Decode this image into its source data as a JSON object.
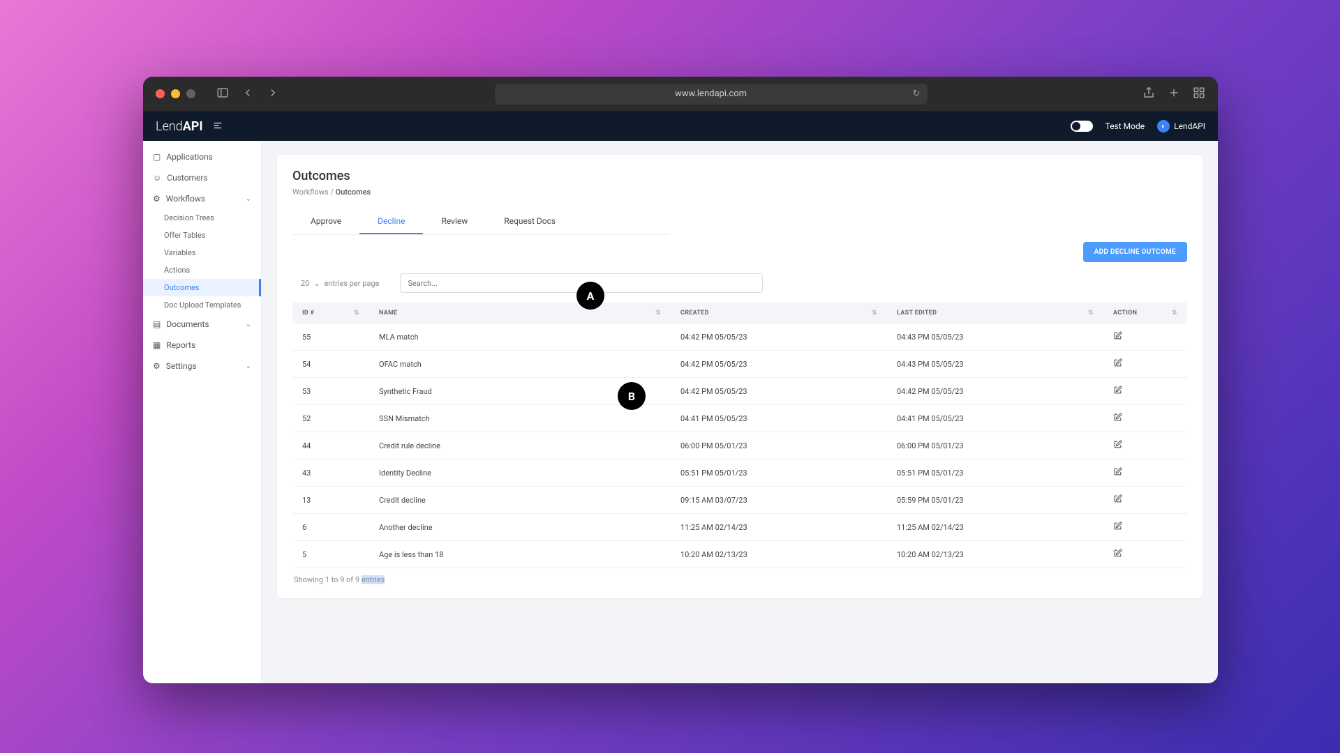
{
  "browser": {
    "url": "www.lendapi.com"
  },
  "header": {
    "brand_pre": "Lend",
    "brand_post": "API",
    "toggle_label": "Test Mode",
    "tenant": "LendAPI"
  },
  "sidebar": {
    "items": [
      {
        "label": "Applications"
      },
      {
        "label": "Customers"
      },
      {
        "label": "Workflows"
      }
    ],
    "workflow_children": [
      {
        "label": "Decision Trees"
      },
      {
        "label": "Offer Tables"
      },
      {
        "label": "Variables"
      },
      {
        "label": "Actions"
      },
      {
        "label": "Outcomes"
      },
      {
        "label": "Doc Upload Templates"
      }
    ],
    "items2": [
      {
        "label": "Documents"
      },
      {
        "label": "Reports"
      },
      {
        "label": "Settings"
      }
    ]
  },
  "page": {
    "title": "Outcomes",
    "breadcrumb_root": "Workflows",
    "breadcrumb_current": "Outcomes"
  },
  "tabs": [
    {
      "label": "Approve"
    },
    {
      "label": "Decline"
    },
    {
      "label": "Review"
    },
    {
      "label": "Request Docs"
    }
  ],
  "add_button": "ADD DECLINE OUTCOME",
  "entries": {
    "size": "20",
    "suffix": "entries per page"
  },
  "search": {
    "placeholder": "Search..."
  },
  "columns": {
    "id": "ID #",
    "name": "NAME",
    "created": "CREATED",
    "last_edited": "LAST EDITED",
    "action": "ACTION"
  },
  "rows": [
    {
      "id": "55",
      "name": "MLA match",
      "created": "04:42 PM 05/05/23",
      "edited": "04:43 PM 05/05/23"
    },
    {
      "id": "54",
      "name": "OFAC match",
      "created": "04:42 PM 05/05/23",
      "edited": "04:43 PM 05/05/23"
    },
    {
      "id": "53",
      "name": "Synthetic Fraud",
      "created": "04:42 PM 05/05/23",
      "edited": "04:42 PM 05/05/23"
    },
    {
      "id": "52",
      "name": "SSN Mismatch",
      "created": "04:41 PM 05/05/23",
      "edited": "04:41 PM 05/05/23"
    },
    {
      "id": "44",
      "name": "Credit rule decline",
      "created": "06:00 PM 05/01/23",
      "edited": "06:00 PM 05/01/23"
    },
    {
      "id": "43",
      "name": "Identity Decline",
      "created": "05:51 PM 05/01/23",
      "edited": "05:51 PM 05/01/23"
    },
    {
      "id": "13",
      "name": "Credit decline",
      "created": "09:15 AM 03/07/23",
      "edited": "05:59 PM 05/01/23"
    },
    {
      "id": "6",
      "name": "Another decline",
      "created": "11:25 AM 02/14/23",
      "edited": "11:25 AM 02/14/23"
    },
    {
      "id": "5",
      "name": "Age is less than 18",
      "created": "10:20 AM 02/13/23",
      "edited": "10:20 AM 02/13/23"
    }
  ],
  "footer": {
    "pre": "Showing 1 to 9 of 9 ",
    "sel": "entries"
  },
  "markers": {
    "a": "A",
    "b": "B"
  }
}
